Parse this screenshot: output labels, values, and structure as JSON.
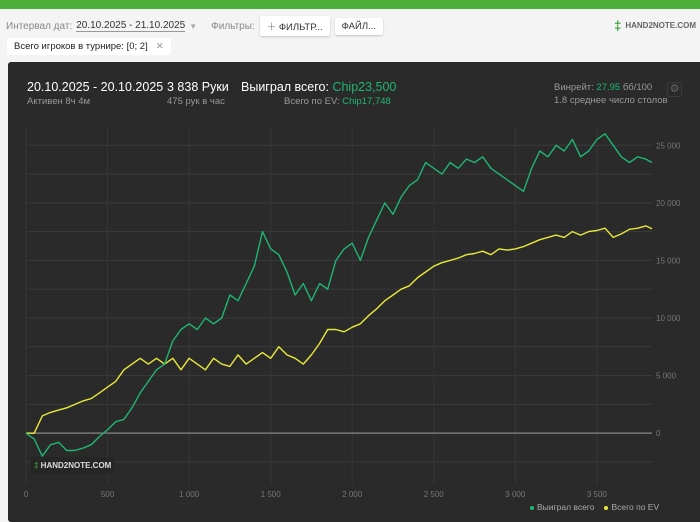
{
  "toolbar": {
    "interval_label": "Интервал дат:",
    "interval_value": "20.10.2025 - 21.10.2025",
    "filters_label": "Фильтры:",
    "filter_button": "ФИЛЬТР...",
    "file_button": "ФАЙЛ..."
  },
  "logo": {
    "text": "HAND2NOTE.COM"
  },
  "chip": {
    "label": "Всего игроков в турнире: [0; 2]"
  },
  "summary": {
    "date_range": "20.10.2025 - 20.10.2025",
    "active": "Активен 8ч 4м",
    "hands": "3 838 Руки",
    "hands_per_hour": "475 рук в час",
    "won_label": "Выиграл всего:",
    "won_value": "Chip23,500",
    "ev_label": "Всего по EV:",
    "ev_value": "Chip17,748",
    "winrate_label": "Винрейт:",
    "winrate_value": "27.95",
    "winrate_unit": "бб/100",
    "tables": "1.8 среднее число столов"
  },
  "watermark": "HAND2NOTE.COM",
  "colors": {
    "won": "#1fb573",
    "ev": "#e8e83a",
    "accent": "#4caf3a"
  },
  "chart_data": {
    "type": "line",
    "xlim": [
      0,
      3838
    ],
    "ylim": [
      -4500,
      26500
    ],
    "x_ticks": [
      0,
      500,
      1000,
      1500,
      2000,
      2500,
      3000,
      3500
    ],
    "x_tick_labels": [
      "0",
      "500",
      "1 000",
      "1 500",
      "2 000",
      "2 500",
      "3 000",
      "3 500"
    ],
    "y_ticks": [
      0,
      5000,
      10000,
      15000,
      20000,
      25000
    ],
    "y_tick_labels": [
      "0",
      "5 000",
      "10 000",
      "15 000",
      "20 000",
      "25 000"
    ],
    "legend": "bottom-right",
    "x": [
      0,
      50,
      100,
      150,
      200,
      250,
      300,
      350,
      400,
      450,
      500,
      550,
      600,
      650,
      700,
      750,
      800,
      850,
      900,
      950,
      1000,
      1050,
      1100,
      1150,
      1200,
      1250,
      1300,
      1350,
      1400,
      1450,
      1500,
      1550,
      1600,
      1650,
      1700,
      1750,
      1800,
      1850,
      1900,
      1950,
      2000,
      2050,
      2100,
      2150,
      2200,
      2250,
      2300,
      2350,
      2400,
      2450,
      2500,
      2550,
      2600,
      2650,
      2700,
      2750,
      2800,
      2850,
      2900,
      2950,
      3000,
      3050,
      3100,
      3150,
      3200,
      3250,
      3300,
      3350,
      3400,
      3450,
      3500,
      3550,
      3600,
      3650,
      3700,
      3750,
      3800,
      3838
    ],
    "series": [
      {
        "name": "Выиграл всего",
        "values": [
          0,
          -500,
          -2000,
          -1000,
          -800,
          -1500,
          -1500,
          -1300,
          -1000,
          -300,
          300,
          1000,
          1200,
          2200,
          3500,
          4500,
          5500,
          6000,
          8000,
          9000,
          9500,
          9000,
          10000,
          9500,
          10000,
          12000,
          11500,
          13000,
          14500,
          17500,
          16000,
          15500,
          14000,
          12000,
          13000,
          11500,
          13000,
          12500,
          15000,
          16000,
          16500,
          15000,
          17000,
          18500,
          20000,
          19000,
          20500,
          21500,
          22000,
          23500,
          23000,
          22500,
          23500,
          23000,
          23800,
          23500,
          24000,
          23000,
          22500,
          22000,
          21500,
          21000,
          23000,
          24500,
          24000,
          25000,
          24500,
          25500,
          24000,
          24500,
          25500,
          26000,
          25000,
          24000,
          23500,
          24000,
          23800,
          23500
        ]
      },
      {
        "name": "Всего по EV",
        "values": [
          0,
          0,
          1500,
          1800,
          2000,
          2200,
          2500,
          2800,
          3000,
          3500,
          4000,
          4500,
          5500,
          6000,
          6500,
          6000,
          6500,
          6000,
          6500,
          5500,
          6500,
          6000,
          5500,
          6500,
          6000,
          5800,
          6800,
          6000,
          6500,
          7000,
          6500,
          7500,
          6800,
          6500,
          6000,
          6800,
          7800,
          9000,
          9000,
          8800,
          9200,
          9500,
          10200,
          10800,
          11500,
          12000,
          12500,
          12800,
          13500,
          14000,
          14500,
          14800,
          15000,
          15200,
          15500,
          15600,
          15800,
          15500,
          16000,
          15900,
          16000,
          16200,
          16500,
          16800,
          17000,
          17200,
          17000,
          17500,
          17200,
          17500,
          17600,
          17800,
          17000,
          17300,
          17700,
          17800,
          18000,
          17748
        ]
      }
    ]
  }
}
